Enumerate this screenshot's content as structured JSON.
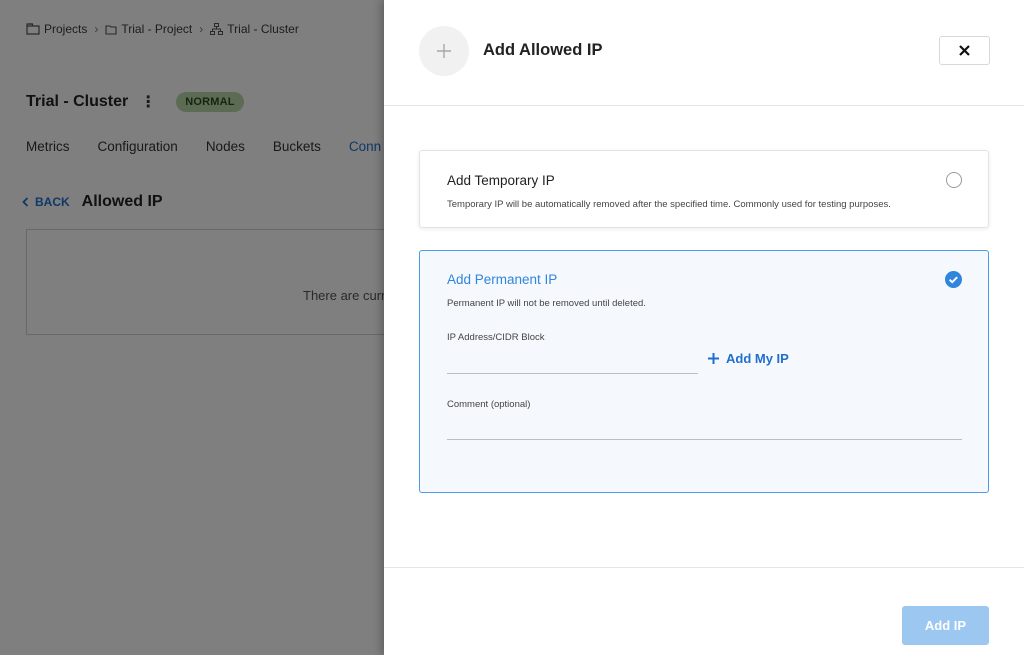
{
  "breadcrumb": {
    "items": [
      {
        "label": "Projects",
        "icon": "folder-icon"
      },
      {
        "label": "Trial - Project",
        "icon": "folder-icon"
      },
      {
        "label": "Trial - Cluster",
        "icon": "cluster-icon"
      }
    ],
    "separator": "›"
  },
  "cluster": {
    "title": "Trial - Cluster",
    "menu_icon": "⋮",
    "status": "NORMAL",
    "status_color": "#b8d9a9"
  },
  "tabs": [
    {
      "label": "Metrics"
    },
    {
      "label": "Configuration"
    },
    {
      "label": "Nodes"
    },
    {
      "label": "Buckets"
    },
    {
      "label": "Conn"
    }
  ],
  "section": {
    "back_label": "BACK",
    "title": "Allowed IP",
    "empty_message": "There are curr"
  },
  "drawer": {
    "title": "Add Allowed IP",
    "close_symbol": "✕",
    "temporary": {
      "title": "Add Temporary IP",
      "description": "Temporary IP will be automatically removed after the specified time. Commonly used for testing purposes.",
      "selected": false
    },
    "permanent": {
      "title": "Add Permanent IP",
      "description": "Permanent IP will not be removed until deleted.",
      "selected": true,
      "ip_label": "IP Address/CIDR Block",
      "ip_value": "",
      "add_my_ip_label": "Add My IP",
      "comment_label": "Comment (optional)",
      "comment_value": ""
    },
    "submit_label": "Add IP"
  },
  "colors": {
    "accent": "#1f6fcf",
    "selected_border": "#4a9be8",
    "disabled_button": "#9cc7f0"
  }
}
